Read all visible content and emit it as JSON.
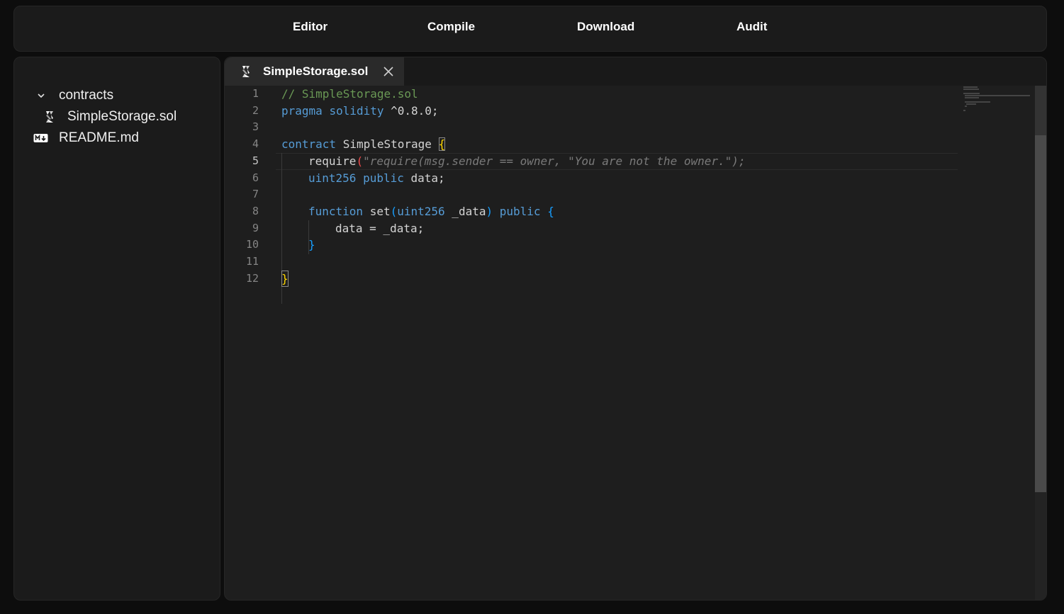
{
  "nav": {
    "editor": "Editor",
    "compile": "Compile",
    "download": "Download",
    "audit": "Audit"
  },
  "sidebar": {
    "folder": {
      "label": "contracts",
      "icon": "chevron-down-icon"
    },
    "files": [
      {
        "label": "SimpleStorage.sol",
        "icon": "solidity-icon"
      },
      {
        "label": "README.md",
        "icon": "markdown-icon"
      }
    ]
  },
  "tab": {
    "label": "SimpleStorage.sol",
    "icon": "solidity-icon",
    "close_icon": "close-icon"
  },
  "editor": {
    "active_line": 5,
    "line_numbers": [
      "1",
      "2",
      "3",
      "4",
      "5",
      "6",
      "7",
      "8",
      "9",
      "10",
      "11",
      "12"
    ],
    "lines": [
      "// SimpleStorage.sol",
      "pragma solidity ^0.8.0;",
      "",
      "contract SimpleStorage {",
      "    require(\"require(msg.sender == owner, \"You are not the owner.\");",
      "    uint256 public data;",
      "",
      "    function set(uint256 _data) public {",
      "        data = _data;",
      "    }",
      "",
      "}"
    ],
    "tokens": {
      "l1": "// SimpleStorage.sol",
      "l2_kw1": "pragma",
      "l2_kw2": "solidity",
      "l2_rest": " ^0.8.0;",
      "l4_kw": "contract",
      "l4_name": " SimpleStorage ",
      "l4_brace": "{",
      "l5_require": "require",
      "l5_paren": "(",
      "l5_quote": "\"",
      "l5_ghost": "require(msg.sender == owner, \"You are not the owner.\");",
      "l6_type": "uint256",
      "l6_pub": "public",
      "l6_rest": " data;",
      "l8_kw": "function",
      "l8_name": " set",
      "l8_open": "(",
      "l8_type": "uint256",
      "l8_param": " _data",
      "l8_close": ")",
      "l8_pub": "public",
      "l8_brace": "{",
      "l9": "data = _data;",
      "l10": "}",
      "l12": "}"
    }
  },
  "colors": {
    "background": "#0d0d0d",
    "panel": "#1b1b1b",
    "editor_bg": "#1e1e1e",
    "keyword": "#569cd6",
    "comment": "#6a9955",
    "bracket_gold": "#ffd700",
    "bracket_blue": "#179fff"
  }
}
